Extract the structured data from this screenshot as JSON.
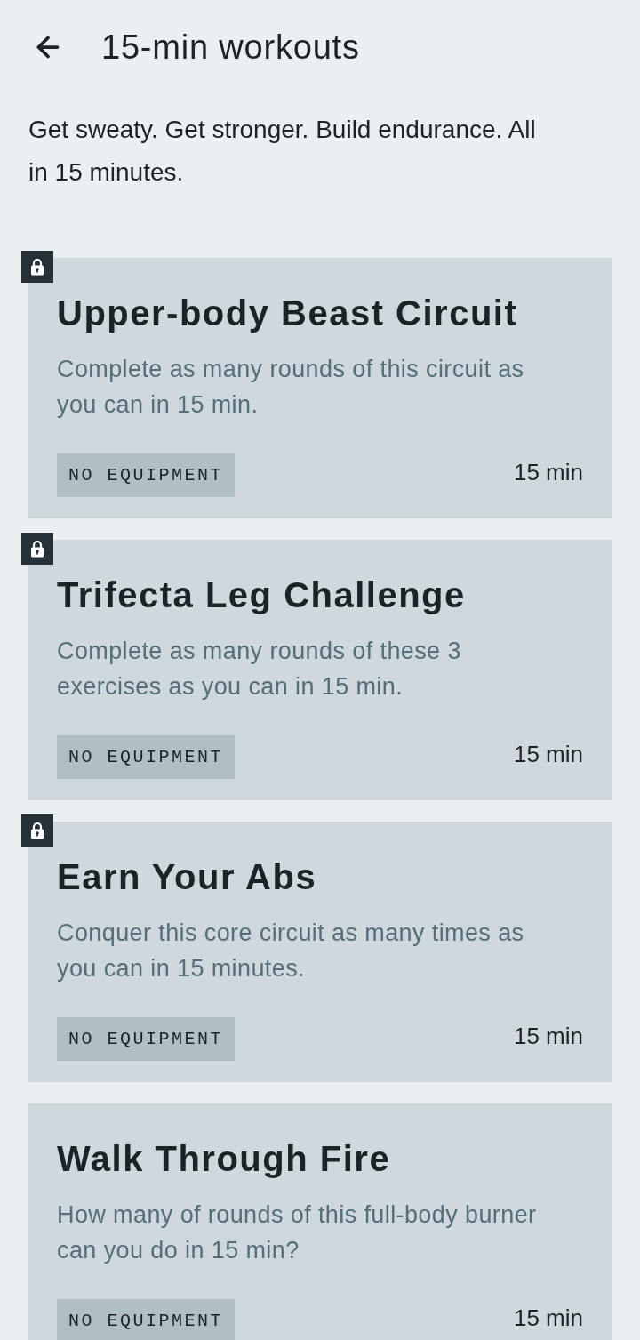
{
  "header": {
    "title": "15-min workouts"
  },
  "intro": "Get sweaty. Get stronger. Build endurance. All in 15 minutes.",
  "cards": [
    {
      "title": "Upper-body Beast Circuit",
      "description": "Complete as many rounds of this circuit as you can in 15 min.",
      "tag": "NO EQUIPMENT",
      "duration": "15 min",
      "locked": true
    },
    {
      "title": "Trifecta Leg Challenge",
      "description": "Complete as many rounds of these 3 exercises as you can in 15 min.",
      "tag": "NO EQUIPMENT",
      "duration": "15 min",
      "locked": true
    },
    {
      "title": "Earn Your Abs",
      "description": "Conquer this core circuit as many times as you can in 15 minutes.",
      "tag": "NO EQUIPMENT",
      "duration": "15 min",
      "locked": true
    },
    {
      "title": "Walk Through Fire",
      "description": "How many of rounds of this full-body burner can you do in 15 min?",
      "tag": "NO EQUIPMENT",
      "duration": "15 min",
      "locked": false
    }
  ]
}
